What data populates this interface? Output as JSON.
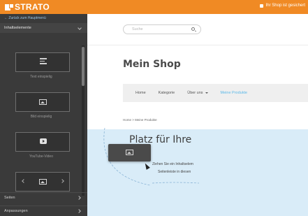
{
  "app": {
    "brand": "STRATO",
    "top_right_text": "Ihr Shop ist gesichert"
  },
  "sidebar": {
    "back_link": "← Zurück zum Hauptmenü",
    "section_title": "Inhaltselemente",
    "widgets": [
      {
        "label": "Text einspielig",
        "icon": "text-icon"
      },
      {
        "label": "Bild einspielig",
        "icon": "image-icon"
      },
      {
        "label": "YouTube-Video",
        "icon": "youtube-icon"
      },
      {
        "label": "",
        "icon": "gallery-icon"
      }
    ],
    "nav": [
      {
        "label": "Seiten"
      },
      {
        "label": "Anpassungen"
      }
    ]
  },
  "main": {
    "search_placeholder": "Suche",
    "shop_title": "Mein Shop",
    "nav_items": [
      {
        "label": "Home",
        "active": false
      },
      {
        "label": "Kategorie",
        "active": false
      },
      {
        "label": "Über uns",
        "active": false,
        "dropdown": true
      },
      {
        "label": "Meine Produkte",
        "active": true
      }
    ],
    "breadcrumb": "Home > Meine Produkte",
    "placeholder_title": "Platz für Ihre",
    "placeholder_line1": "Ziehen Sie ein Inhaltselem",
    "placeholder_line2": "Seitenleiste in diesen"
  },
  "colors": {
    "topbar": "#f08a24",
    "sidebar": "#3a3a3a",
    "drop_zone": "#d9ecf8",
    "active_nav": "#5ab8e8"
  }
}
